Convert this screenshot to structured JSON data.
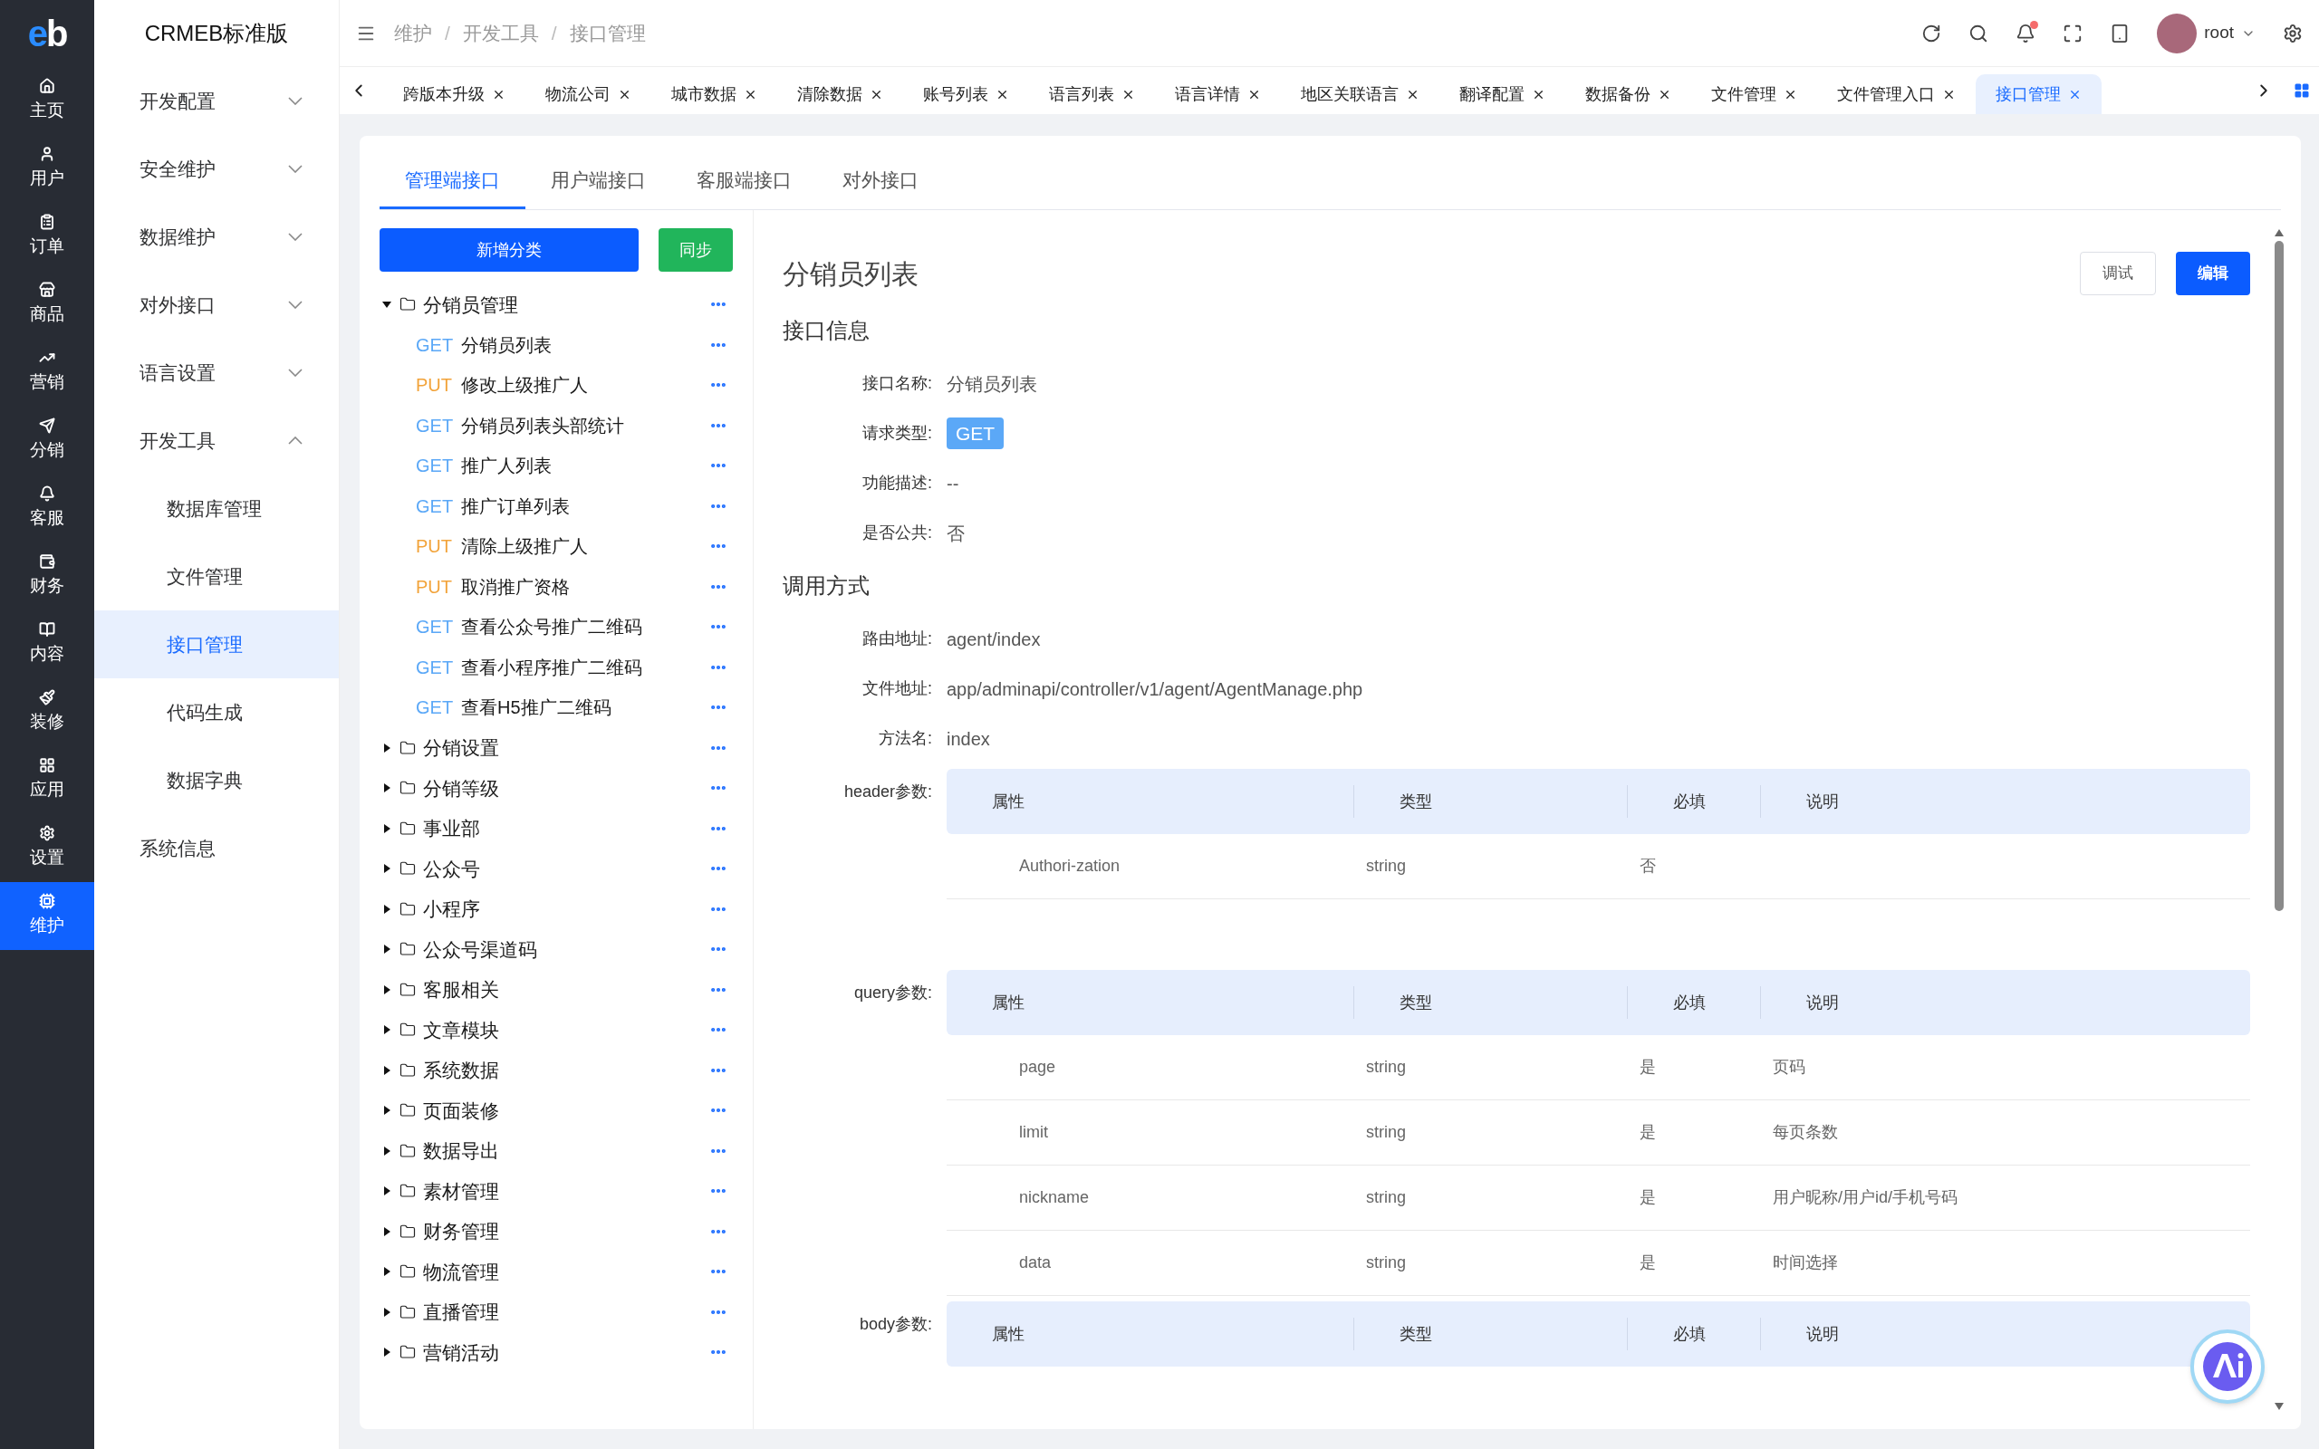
{
  "nav": {
    "logo": "eb",
    "items": [
      {
        "label": "主页",
        "selected": false
      },
      {
        "label": "用户",
        "selected": false
      },
      {
        "label": "订单",
        "selected": false
      },
      {
        "label": "商品",
        "selected": false
      },
      {
        "label": "营销",
        "selected": false
      },
      {
        "label": "分销",
        "selected": false
      },
      {
        "label": "客服",
        "selected": false
      },
      {
        "label": "财务",
        "selected": false
      },
      {
        "label": "内容",
        "selected": false
      },
      {
        "label": "装修",
        "selected": false
      },
      {
        "label": "应用",
        "selected": false
      },
      {
        "label": "设置",
        "selected": false
      },
      {
        "label": "维护",
        "selected": true
      }
    ]
  },
  "sidebar": {
    "title": "CRMEB标准版",
    "items": [
      {
        "label": "开发配置",
        "kind": "group",
        "expanded": false
      },
      {
        "label": "安全维护",
        "kind": "group",
        "expanded": false
      },
      {
        "label": "数据维护",
        "kind": "group",
        "expanded": false
      },
      {
        "label": "对外接口",
        "kind": "group",
        "expanded": false
      },
      {
        "label": "语言设置",
        "kind": "group",
        "expanded": false
      },
      {
        "label": "开发工具",
        "kind": "group",
        "expanded": true,
        "children": [
          {
            "label": "数据库管理",
            "selected": false
          },
          {
            "label": "文件管理",
            "selected": false
          },
          {
            "label": "接口管理",
            "selected": true
          },
          {
            "label": "代码生成",
            "selected": false
          },
          {
            "label": "数据字典",
            "selected": false
          }
        ]
      },
      {
        "label": "系统信息",
        "kind": "item"
      }
    ]
  },
  "header": {
    "breadcrumb": [
      "维护",
      "开发工具",
      "接口管理"
    ],
    "breadcrumb_separator": "/",
    "notifications_unread": true,
    "user": "root"
  },
  "page_tabs": [
    {
      "label": "跨版本升级",
      "selected": false
    },
    {
      "label": "物流公司",
      "selected": false
    },
    {
      "label": "城市数据",
      "selected": false
    },
    {
      "label": "清除数据",
      "selected": false
    },
    {
      "label": "账号列表",
      "selected": false
    },
    {
      "label": "语言列表",
      "selected": false
    },
    {
      "label": "语言详情",
      "selected": false
    },
    {
      "label": "地区关联语言",
      "selected": false
    },
    {
      "label": "翻译配置",
      "selected": false
    },
    {
      "label": "数据备份",
      "selected": false
    },
    {
      "label": "文件管理",
      "selected": false
    },
    {
      "label": "文件管理入口",
      "selected": false
    },
    {
      "label": "接口管理",
      "selected": true
    }
  ],
  "api_tabs": [
    {
      "label": "管理端接口",
      "selected": true
    },
    {
      "label": "用户端接口",
      "selected": false
    },
    {
      "label": "客服端接口",
      "selected": false
    },
    {
      "label": "对外接口",
      "selected": false
    }
  ],
  "tree": {
    "add_button": "新增分类",
    "sync_button": "同步",
    "folders": [
      {
        "label": "分销员管理",
        "expanded": true,
        "children": [
          {
            "method": "GET",
            "name": "分销员列表",
            "color": "#5ba8f7"
          },
          {
            "method": "PUT",
            "name": "修改上级推广人",
            "color": "#f2a33a"
          },
          {
            "method": "GET",
            "name": "分销员列表头部统计",
            "color": "#5ba8f7"
          },
          {
            "method": "GET",
            "name": "推广人列表",
            "color": "#5ba8f7"
          },
          {
            "method": "GET",
            "name": "推广订单列表",
            "color": "#5ba8f7"
          },
          {
            "method": "PUT",
            "name": "清除上级推广人",
            "color": "#f2a33a"
          },
          {
            "method": "PUT",
            "name": "取消推广资格",
            "color": "#f2a33a"
          },
          {
            "method": "GET",
            "name": "查看公众号推广二维码",
            "color": "#5ba8f7"
          },
          {
            "method": "GET",
            "name": "查看小程序推广二维码",
            "color": "#5ba8f7"
          },
          {
            "method": "GET",
            "name": "查看H5推广二维码",
            "color": "#5ba8f7"
          }
        ]
      },
      {
        "label": "分销设置",
        "expanded": false
      },
      {
        "label": "分销等级",
        "expanded": false
      },
      {
        "label": "事业部",
        "expanded": false
      },
      {
        "label": "公众号",
        "expanded": false
      },
      {
        "label": "小程序",
        "expanded": false
      },
      {
        "label": "公众号渠道码",
        "expanded": false
      },
      {
        "label": "客服相关",
        "expanded": false
      },
      {
        "label": "文章模块",
        "expanded": false
      },
      {
        "label": "系统数据",
        "expanded": false
      },
      {
        "label": "页面装修",
        "expanded": false
      },
      {
        "label": "数据导出",
        "expanded": false
      },
      {
        "label": "素材管理",
        "expanded": false
      },
      {
        "label": "财务管理",
        "expanded": false
      },
      {
        "label": "物流管理",
        "expanded": false
      },
      {
        "label": "直播管理",
        "expanded": false
      },
      {
        "label": "营销活动",
        "expanded": false
      }
    ]
  },
  "detail": {
    "title": "分销员列表",
    "debug_button": "调试",
    "edit_button": "编辑",
    "sections": [
      {
        "heading": "接口信息",
        "fields": [
          {
            "label": "接口名称:",
            "value": "分销员列表",
            "kind": "text"
          },
          {
            "label": "请求类型:",
            "value": "GET",
            "kind": "badge"
          },
          {
            "label": "功能描述:",
            "value": "--",
            "kind": "text"
          },
          {
            "label": "是否公共:",
            "value": "否",
            "kind": "text"
          }
        ]
      },
      {
        "heading": "调用方式",
        "fields": [
          {
            "label": "路由地址:",
            "value": "agent/index",
            "kind": "text"
          },
          {
            "label": "文件地址:",
            "value": "app/adminapi/controller/v1/agent/AgentManage.php",
            "kind": "text"
          },
          {
            "label": "方法名:",
            "value": "index",
            "kind": "text"
          }
        ]
      }
    ],
    "params": [
      {
        "label": "header参数:",
        "columns": [
          "属性",
          "类型",
          "必填",
          "说明"
        ],
        "rows": [
          {
            "name": "Authori-zation",
            "type": "string",
            "required": "否"
          }
        ]
      },
      {
        "label": "query参数:",
        "columns": [
          "属性",
          "类型",
          "必填",
          "说明"
        ],
        "rows": [
          {
            "name": "page",
            "type": "string",
            "required": "是",
            "desc": "页码"
          },
          {
            "name": "limit",
            "type": "string",
            "required": "是",
            "desc": "每页条数"
          },
          {
            "name": "nickname",
            "type": "string",
            "required": "是",
            "desc": "用户昵称/用户id/手机号码"
          },
          {
            "name": "data",
            "type": "string",
            "required": "是",
            "desc": "时间选择"
          }
        ]
      },
      {
        "label": "body参数:",
        "columns": [
          "属性",
          "类型",
          "必填",
          "说明"
        ]
      }
    ]
  }
}
